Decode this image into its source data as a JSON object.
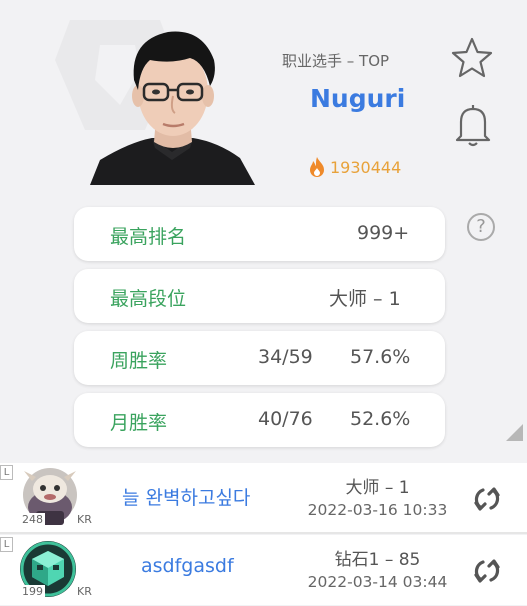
{
  "player": {
    "role": "职业选手 – TOP",
    "name": "Nuguri",
    "hotness": "1930444"
  },
  "stats": [
    {
      "label": "最高排名",
      "value": "999+",
      "ratio": "",
      "percent": ""
    },
    {
      "label": "最高段位",
      "value": "大师 – 1",
      "ratio": "",
      "percent": ""
    },
    {
      "label": "周胜率",
      "value": "",
      "ratio": "34/59",
      "percent": "57.6%"
    },
    {
      "label": "月胜率",
      "value": "",
      "ratio": "40/76",
      "percent": "52.6%"
    }
  ],
  "accounts": [
    {
      "badge": "L",
      "level": "248",
      "region": "KR",
      "name": "늘 완벽하고싶다",
      "rank": "大师 – 1",
      "date": "2022-03-16 10:33",
      "icon": "poro-icon"
    },
    {
      "badge": "L",
      "level": "199",
      "region": "KR",
      "name": "asdfgasdf",
      "rank": "钻石1 – 85",
      "date": "2022-03-14 03:44",
      "icon": "cube-icon"
    }
  ],
  "help_glyph": "?",
  "colors": {
    "accent_blue": "#3b7be0",
    "stat_green": "#3aa35e",
    "hot_orange": "#e8a23a"
  }
}
